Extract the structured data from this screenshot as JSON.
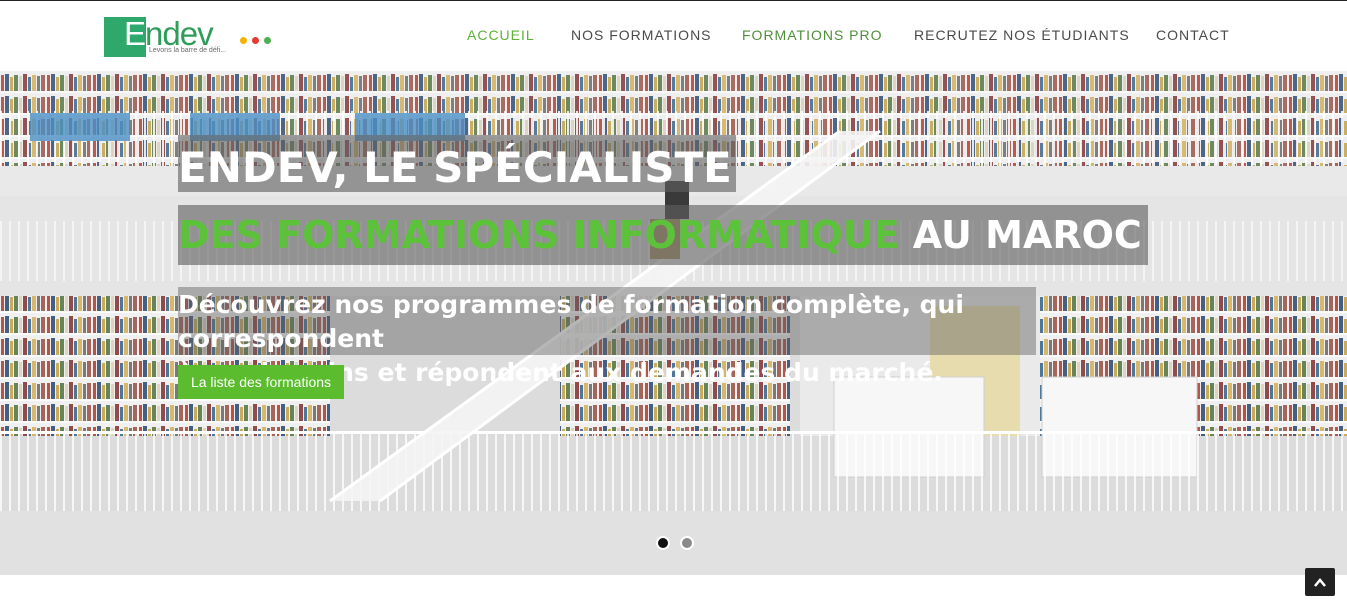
{
  "logo": {
    "wordmark_first": "E",
    "wordmark_rest": "ndev",
    "tagline": "Levons la barre de défi...",
    "dot_colors": [
      "#f2b400",
      "#e53a2f",
      "#4caf50"
    ]
  },
  "nav": {
    "items": [
      {
        "label": "ACCUEIL",
        "color": "#5cb334"
      },
      {
        "label": "NOS FORMATIONS",
        "color": "#4a4a4a"
      },
      {
        "label": "FORMATIONS PRO",
        "color": "#4f8f39"
      },
      {
        "label": "RECRUTEZ NOS ÉTUDIANTS",
        "color": "#4a4a4a"
      },
      {
        "label": "CONTACT",
        "color": "#4a4a4a"
      }
    ]
  },
  "hero": {
    "title_line1": "ENDEV, LE SPÉCIALISTE",
    "title_line2_green": "DES FORMATIONS INFORMATIQUE",
    "title_line2_rest": " AU MAROC",
    "subtitle_line1": "Découvrez nos programmes de formation complète, qui correspondent",
    "subtitle_line2": "à vos besoins et répondent aux demandes du marché.",
    "cta_label": "La liste des formations",
    "slider": {
      "slide_count": 2,
      "active_index": 0
    }
  },
  "colors": {
    "brand_green": "#5bbd2e",
    "logo_green": "#2fa86b"
  },
  "icons": {
    "scroll_top": "chevron-up-icon"
  }
}
